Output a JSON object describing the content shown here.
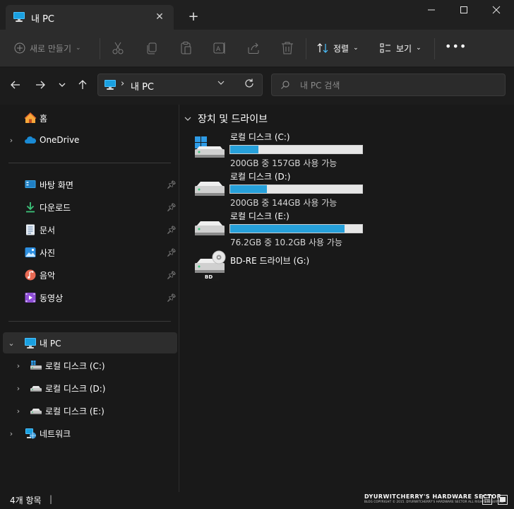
{
  "window": {
    "tab_title": "내 PC",
    "tab_close_glyph": "✕",
    "new_tab_glyph": "+",
    "minimize_glyph": "—",
    "maximize_glyph": "☐",
    "close_glyph": "✕"
  },
  "toolbar": {
    "new_label": "새로 만들기",
    "sort_label": "정렬",
    "view_label": "보기",
    "more_glyph": "•••",
    "icons": [
      "cut-icon",
      "copy-icon",
      "paste-icon",
      "rename-icon",
      "share-icon",
      "delete-icon"
    ]
  },
  "address": {
    "path": "내 PC",
    "separator": "›",
    "search_placeholder": "내 PC 검색"
  },
  "sidebar": {
    "home": "홈",
    "onedrive": "OneDrive",
    "quick_access": [
      {
        "label": "바탕 화면",
        "icon": "desktop-icon"
      },
      {
        "label": "다운로드",
        "icon": "download-icon"
      },
      {
        "label": "문서",
        "icon": "document-icon"
      },
      {
        "label": "사진",
        "icon": "pictures-icon"
      },
      {
        "label": "음악",
        "icon": "music-icon"
      },
      {
        "label": "동영상",
        "icon": "video-icon"
      }
    ],
    "this_pc": "내 PC",
    "drives": [
      "로컬 디스크 (C:)",
      "로컬 디스크 (D:)",
      "로컬 디스크 (E:)"
    ],
    "network": "네트워크"
  },
  "main": {
    "group_title": "장치 및 드라이브",
    "drives": [
      {
        "name": "로컬 디스크 (C:)",
        "info": "200GB 중 157GB 사용 가능",
        "used_fraction": 0.215
      },
      {
        "name": "로컬 디스크 (D:)",
        "info": "200GB 중 144GB 사용 가능",
        "used_fraction": 0.28
      },
      {
        "name": "로컬 디스크 (E:)",
        "info": "76.2GB 중 10.2GB 사용 가능",
        "used_fraction": 0.866
      }
    ],
    "optical": {
      "name": "BD-RE 드라이브 (G:)",
      "badge": "BD"
    }
  },
  "status": {
    "count": "4개 항목",
    "separator": "|",
    "watermark_main": "DYURWITCHERRY'S HARDWARE SECTOR",
    "watermark_sub": "BLOG COPYRIGHT © 2015. DYURWITCHERRY'S HARDWARE SECTOR ALL RIGHTS RESERVED."
  },
  "colors": {
    "accent": "#26a0da",
    "pc_icon": "#4cc2ff",
    "background": "#191919",
    "toolbar": "#2c2c2c"
  }
}
